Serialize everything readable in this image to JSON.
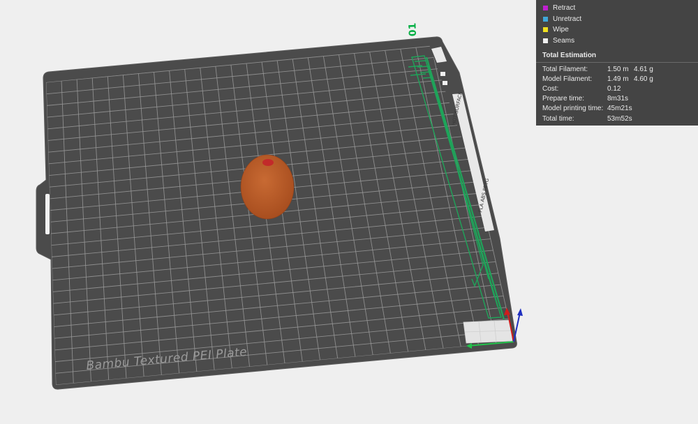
{
  "viewport": {
    "plate_name": "Bambu Textured PEI Plate",
    "plate_number": "01",
    "side_text_surface": "HOT SURFACE",
    "side_text_filaments": "PLA ABS PETG"
  },
  "legend": {
    "items": [
      {
        "label": "Retract",
        "color": "#c020d0"
      },
      {
        "label": "Unretract",
        "color": "#40a8d8"
      },
      {
        "label": "Wipe",
        "color": "#f0e020"
      },
      {
        "label": "Seams",
        "color": "#f0f0f0"
      }
    ]
  },
  "estimation": {
    "title": "Total Estimation",
    "rows": [
      {
        "label": "Total Filament:",
        "v1": "1.50 m",
        "v2": "4.61 g"
      },
      {
        "label": "Model Filament:",
        "v1": "1.49 m",
        "v2": "4.60 g"
      },
      {
        "label": "Cost:",
        "v1": "0.12",
        "v2": ""
      },
      {
        "label": "Prepare time:",
        "v1": "8m31s",
        "v2": ""
      },
      {
        "label": "Model printing time:",
        "v1": "45m21s",
        "v2": ""
      },
      {
        "label": "Total time:",
        "v1": "53m52s",
        "v2": ""
      }
    ]
  }
}
